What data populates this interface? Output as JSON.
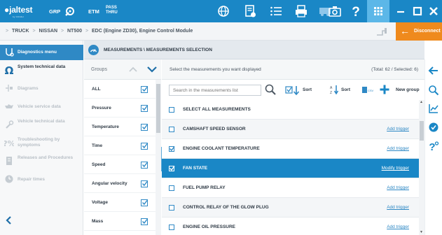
{
  "topbar": {
    "logo": "jaltest",
    "logo_sub": "by COJALI",
    "grp_label": "GRP",
    "etm_label": "ETM",
    "pass_line1": "PASS",
    "pass_line2": "THRU",
    "icons": [
      "wrench-gear-icon",
      "globe-icon",
      "document-check-icon",
      "list-icon",
      "printer-icon",
      "truck-icon",
      "camera-icon",
      "help-icon",
      "grid-icon",
      "minimize-icon",
      "maximize-icon",
      "close-icon"
    ]
  },
  "breadcrumb": {
    "items": [
      "TRUCK",
      "NISSAN",
      "NT500",
      "EDC (Engine ZD30), Engine Control Module"
    ],
    "disconnect_label": "Disconnect"
  },
  "sidebar": {
    "items": [
      {
        "label": "Diagnostics menu",
        "icon": "diagnostics-icon",
        "state": "active"
      },
      {
        "label": "System technical data",
        "icon": "omega-icon",
        "state": "strong"
      },
      {
        "label": "Diagrams",
        "icon": "diagram-icon",
        "state": "disabled"
      },
      {
        "label": "Vehicle service data",
        "icon": "oil-can-icon",
        "state": "disabled"
      },
      {
        "label": "Vehicle technical data",
        "icon": "wrench-icon",
        "state": "disabled"
      },
      {
        "label": "Troubleshooting by symptoms",
        "icon": "troubleshoot-icon",
        "state": "disabled"
      },
      {
        "label": "Releases and Procedures",
        "icon": "procedures-icon",
        "state": "disabled"
      },
      {
        "label": "Repair times",
        "icon": "repair-times-icon",
        "state": "disabled"
      }
    ]
  },
  "main": {
    "header": "MEASUREMENTS \\ MEASUREMENTS SELECTION"
  },
  "groups": {
    "title": "Groups",
    "items": [
      {
        "label": "ALL",
        "checked": true
      },
      {
        "label": "Pressure",
        "checked": true
      },
      {
        "label": "Temperature",
        "checked": true
      },
      {
        "label": "Time",
        "checked": true
      },
      {
        "label": "Speed",
        "checked": true
      },
      {
        "label": "Angular velocity",
        "checked": true
      },
      {
        "label": "Voltage",
        "checked": true
      },
      {
        "label": "Mass",
        "checked": true
      }
    ]
  },
  "measurements": {
    "instruction": "Select the measurements you want displayed",
    "totals": "(Total: 62 / Selected: 6)",
    "search_placeholder": "Search in the measurements list",
    "sort1_label": "Sort",
    "sort2_label": "Sort",
    "new_group_label": "New group",
    "rows": [
      {
        "name": "SELECT ALL MEASUREMENTS",
        "trigger": "",
        "checked": false,
        "selected": false
      },
      {
        "name": "CAMSHAFT SPEED SENSOR",
        "trigger": "Add trigger",
        "checked": false,
        "selected": false
      },
      {
        "name": "ENGINE COOLANT TEMPERATURE",
        "trigger": "Add trigger",
        "checked": true,
        "selected": false
      },
      {
        "name": "FAN STATE",
        "trigger": "Modify trigger",
        "checked": true,
        "selected": true
      },
      {
        "name": "FUEL PUMP RELAY",
        "trigger": "Add trigger",
        "checked": false,
        "selected": false
      },
      {
        "name": "CONTROL RELAY OF THE GLOW PLUG",
        "trigger": "Add trigger",
        "checked": false,
        "selected": false
      },
      {
        "name": "ENGINE OIL PRESSURE",
        "trigger": "Add trigger",
        "checked": false,
        "selected": false
      }
    ]
  },
  "right_tools": [
    "back-arrow-icon",
    "search-doc-icon",
    "chart-icon",
    "check-circle-icon",
    "question-wrench-icon"
  ],
  "colors": {
    "primary": "#1a87c6",
    "accent_orange": "#ef8a1d",
    "sidebar_active": "#2f89c5"
  }
}
